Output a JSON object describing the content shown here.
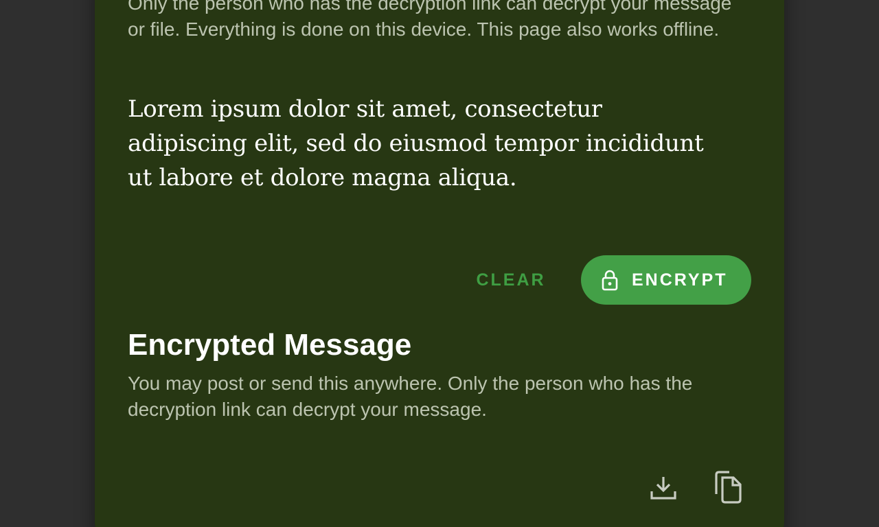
{
  "intro": {
    "text": "Only the person who has the decryption link can decrypt your message or file. Everything is done on this device. This page also works offline."
  },
  "message": {
    "text": "Lorem ipsum dolor sit amet, consectetur\nadipiscing elit, sed do eiusmod tempor incididunt\nut labore et dolore magna aliqua."
  },
  "actions": {
    "clear_label": "CLEAR",
    "encrypt_label": "ENCRYPT",
    "encrypt_icon": "lock-icon"
  },
  "encrypted_section": {
    "title": "Encrypted Message",
    "description": "You may post or send this anywhere. Only the person who has the decryption link can decrypt your message."
  },
  "toolbar": {
    "download_icon": "download-icon",
    "copy_icon": "copy-icon"
  },
  "colors": {
    "background": "#2f2f2f",
    "card": "#273713",
    "accent": "#43a047",
    "muted_text": "#bcc4b0"
  }
}
